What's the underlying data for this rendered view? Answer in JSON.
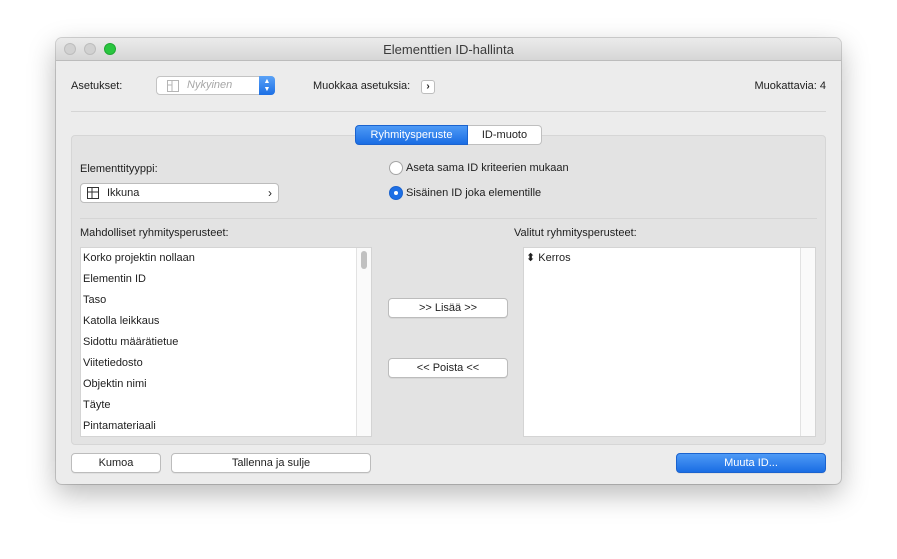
{
  "window": {
    "title": "Elementtien ID-hallinta"
  },
  "header": {
    "settings_label": "Asetukset:",
    "settings_placeholder": "Nykyinen",
    "edit_settings_label": "Muokkaa asetuksia:",
    "edit_settings_chevron": "›",
    "editable_count": "Muokattavia: 4"
  },
  "tabs": [
    {
      "label": "Ryhmitysperuste",
      "selected": true
    },
    {
      "label": "ID-muoto",
      "selected": false
    }
  ],
  "element_type": {
    "label": "Elementtityyppi:",
    "value": "Ikkuna",
    "chevron": "›"
  },
  "id_mode": {
    "options": [
      {
        "label": "Aseta sama ID kriteerien mukaan",
        "selected": false
      },
      {
        "label": "Sisäinen ID joka elementille",
        "selected": true
      }
    ]
  },
  "available": {
    "label": "Mahdolliset ryhmitysperusteet:",
    "items": [
      "Korko projektin nollaan",
      "Elementin ID",
      "Taso",
      "Katolla leikkaus",
      "Sidottu määrätietue",
      "Viitetiedosto",
      "Objektin nimi",
      "Täyte",
      "Pintamateriaali"
    ]
  },
  "selected": {
    "label": "Valitut ryhmitysperusteet:",
    "items": [
      {
        "marker": "⬍",
        "label": "Kerros"
      }
    ]
  },
  "buttons": {
    "add": ">> Lisää >>",
    "remove": "<< Poista <<",
    "undo": "Kumoa",
    "save_close": "Tallenna ja sulje",
    "change_id": "Muuta ID..."
  },
  "colors": {
    "accent": "#1d6fe5",
    "zoom_button": "#2ac640"
  }
}
